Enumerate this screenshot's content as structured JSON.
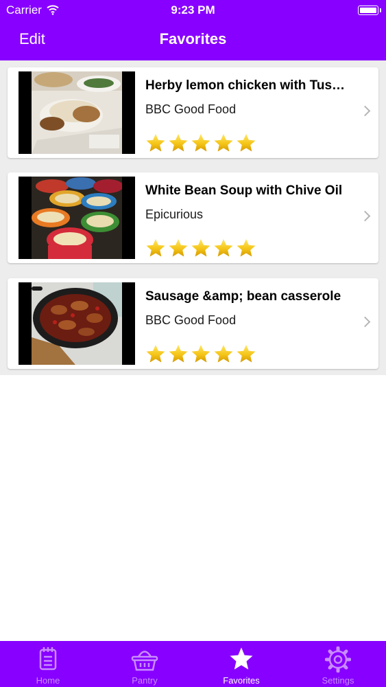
{
  "status_bar": {
    "carrier": "Carrier",
    "time": "9:23 PM"
  },
  "nav": {
    "edit_label": "Edit",
    "title": "Favorites"
  },
  "favorites": [
    {
      "title": "Herby lemon chicken with Tus…",
      "source": "BBC Good Food",
      "rating": 5,
      "image": "roast-chicken-photo"
    },
    {
      "title": "White Bean Soup with Chive Oil",
      "source": "Epicurious",
      "rating": 5,
      "image": "bean-soup-bowls-photo"
    },
    {
      "title": "Sausage &amp; bean casserole",
      "source": "BBC Good Food",
      "rating": 5,
      "image": "sausage-casserole-photo"
    }
  ],
  "tabbar": {
    "tabs": [
      {
        "label": "Home",
        "icon": "notepad-icon",
        "active": false
      },
      {
        "label": "Pantry",
        "icon": "basket-icon",
        "active": false
      },
      {
        "label": "Favorites",
        "icon": "star-icon",
        "active": true
      },
      {
        "label": "Settings",
        "icon": "gear-icon",
        "active": false
      }
    ]
  },
  "colors": {
    "brand_purple": "#8800ff",
    "inactive_tab": "#c98cff",
    "star_gold": "#f5c518",
    "list_background": "#ededed"
  }
}
